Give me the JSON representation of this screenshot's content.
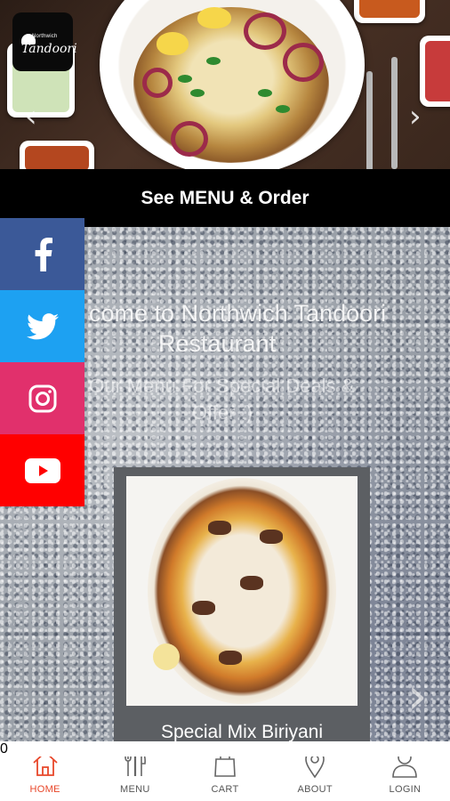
{
  "hero": {
    "logo": {
      "small": "Northwich",
      "big": "Tandoori"
    },
    "arrows": {
      "prev": "‹",
      "next": "›"
    }
  },
  "banner": {
    "label": "See MENU & Order"
  },
  "welcome": {
    "line1": "come to Northwich Tandoori",
    "line2": "Restaurant",
    "sub_line1": "Our Menu For Special Deals &",
    "sub_line2": "Offer :)"
  },
  "featured_dish": {
    "title": "Special Mix Biriyani"
  },
  "carousel": {
    "next": "›"
  },
  "social": [
    {
      "name": "facebook",
      "color": "#3b5998"
    },
    {
      "name": "twitter",
      "color": "#1da1f2"
    },
    {
      "name": "instagram",
      "color": "#e1306c"
    },
    {
      "name": "youtube",
      "color": "#ff0000"
    }
  ],
  "nav": {
    "items": [
      {
        "label": "HOME",
        "icon": "home-icon",
        "active": true
      },
      {
        "label": "MENU",
        "icon": "menu-icon",
        "active": false
      },
      {
        "label": "CART",
        "icon": "cart-icon",
        "active": false
      },
      {
        "label": "ABOUT",
        "icon": "location-icon",
        "active": false
      },
      {
        "label": "LOGIN",
        "icon": "user-icon",
        "active": false
      }
    ],
    "cart_count": "0"
  },
  "colors": {
    "accent": "#e8472a",
    "banner_bg": "#000000",
    "nav_text": "#555555"
  }
}
